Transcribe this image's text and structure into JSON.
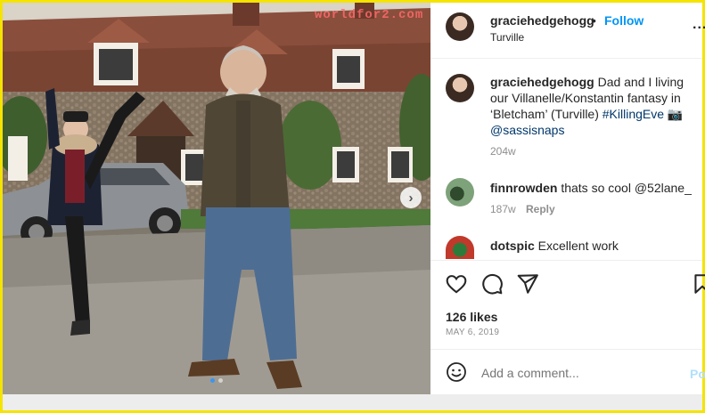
{
  "photo": {
    "watermark": "worldfor2.com",
    "next_icon": "chevron-right-icon",
    "slide_count": 2,
    "active_slide": 1
  },
  "header": {
    "username": "graciehedgehogg",
    "separator": "•",
    "follow_label": "Follow",
    "location": "Turville",
    "more_icon": "ellipsis-icon",
    "more_label": "..."
  },
  "caption": {
    "username": "graciehedgehogg",
    "text": "Dad and I living our Villanelle/Konstantin fantasy in ‘Bletcham’ (Turville)",
    "hashtag": "#KillingEve",
    "emoji": "📷",
    "mention": "@sassisnaps",
    "time": "204w"
  },
  "comments": [
    {
      "username": "finnrowden",
      "text": "thats so cool @52lane_",
      "time": "187w",
      "reply_label": "Reply"
    },
    {
      "username": "dotspic",
      "text": "Excellent work"
    }
  ],
  "actions": {
    "like_icon": "heart-icon",
    "comment_icon": "comment-icon",
    "share_icon": "paper-plane-icon",
    "save_icon": "bookmark-icon"
  },
  "likes": "126 likes",
  "date": "MAY 6, 2019",
  "add_comment": {
    "emoji_icon": "smiley-icon",
    "placeholder": "Add a comment...",
    "post_label": "Po"
  },
  "colors": {
    "follow": "#0095f6",
    "frame": "#f5e300",
    "post_disabled": "#b2dffc"
  }
}
